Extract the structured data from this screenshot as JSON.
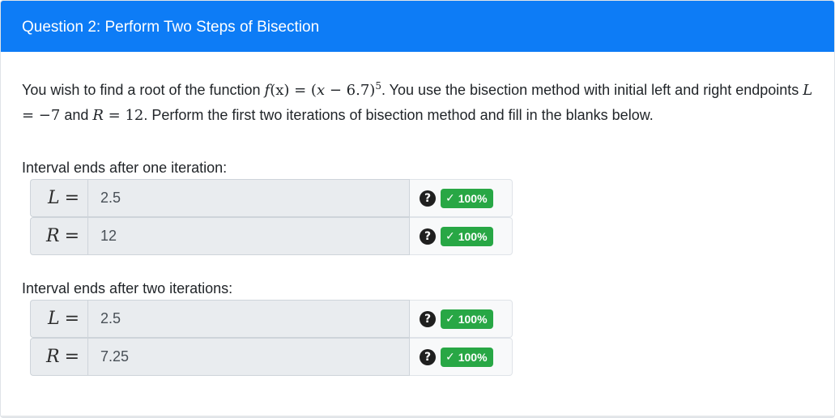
{
  "header": {
    "title": "Question 2: Perform Two Steps of Bisection"
  },
  "prompt": {
    "part1": "You wish to find a root of the function ",
    "func_f": "f",
    "func_x": "(x)",
    "func_eq": " = (",
    "func_x2": "x",
    "func_minus": " − 6.7)",
    "func_exp": "5",
    "part2": ". You use the bisection method with initial left and right endpoints ",
    "L_sym": "L",
    "L_val": " = −7",
    "part3": " and ",
    "R_sym": "R",
    "R_val": " = 12",
    "part4": ". Perform the first two iterations of bisection method and fill in the blanks below."
  },
  "sections": [
    {
      "label": "Interval ends after one iteration:",
      "rows": [
        {
          "var": "L",
          "eq": "=",
          "value": "2.5",
          "help": "?",
          "check": "✓",
          "score": "100%"
        },
        {
          "var": "R",
          "eq": "=",
          "value": "12",
          "help": "?",
          "check": "✓",
          "score": "100%"
        }
      ]
    },
    {
      "label": "Interval ends after two iterations:",
      "rows": [
        {
          "var": "L",
          "eq": "=",
          "value": "2.5",
          "help": "?",
          "check": "✓",
          "score": "100%"
        },
        {
          "var": "R",
          "eq": "=",
          "value": "7.25",
          "help": "?",
          "check": "✓",
          "score": "100%"
        }
      ]
    }
  ],
  "colors": {
    "header": "#0d7cf6",
    "badge": "#28a745"
  }
}
